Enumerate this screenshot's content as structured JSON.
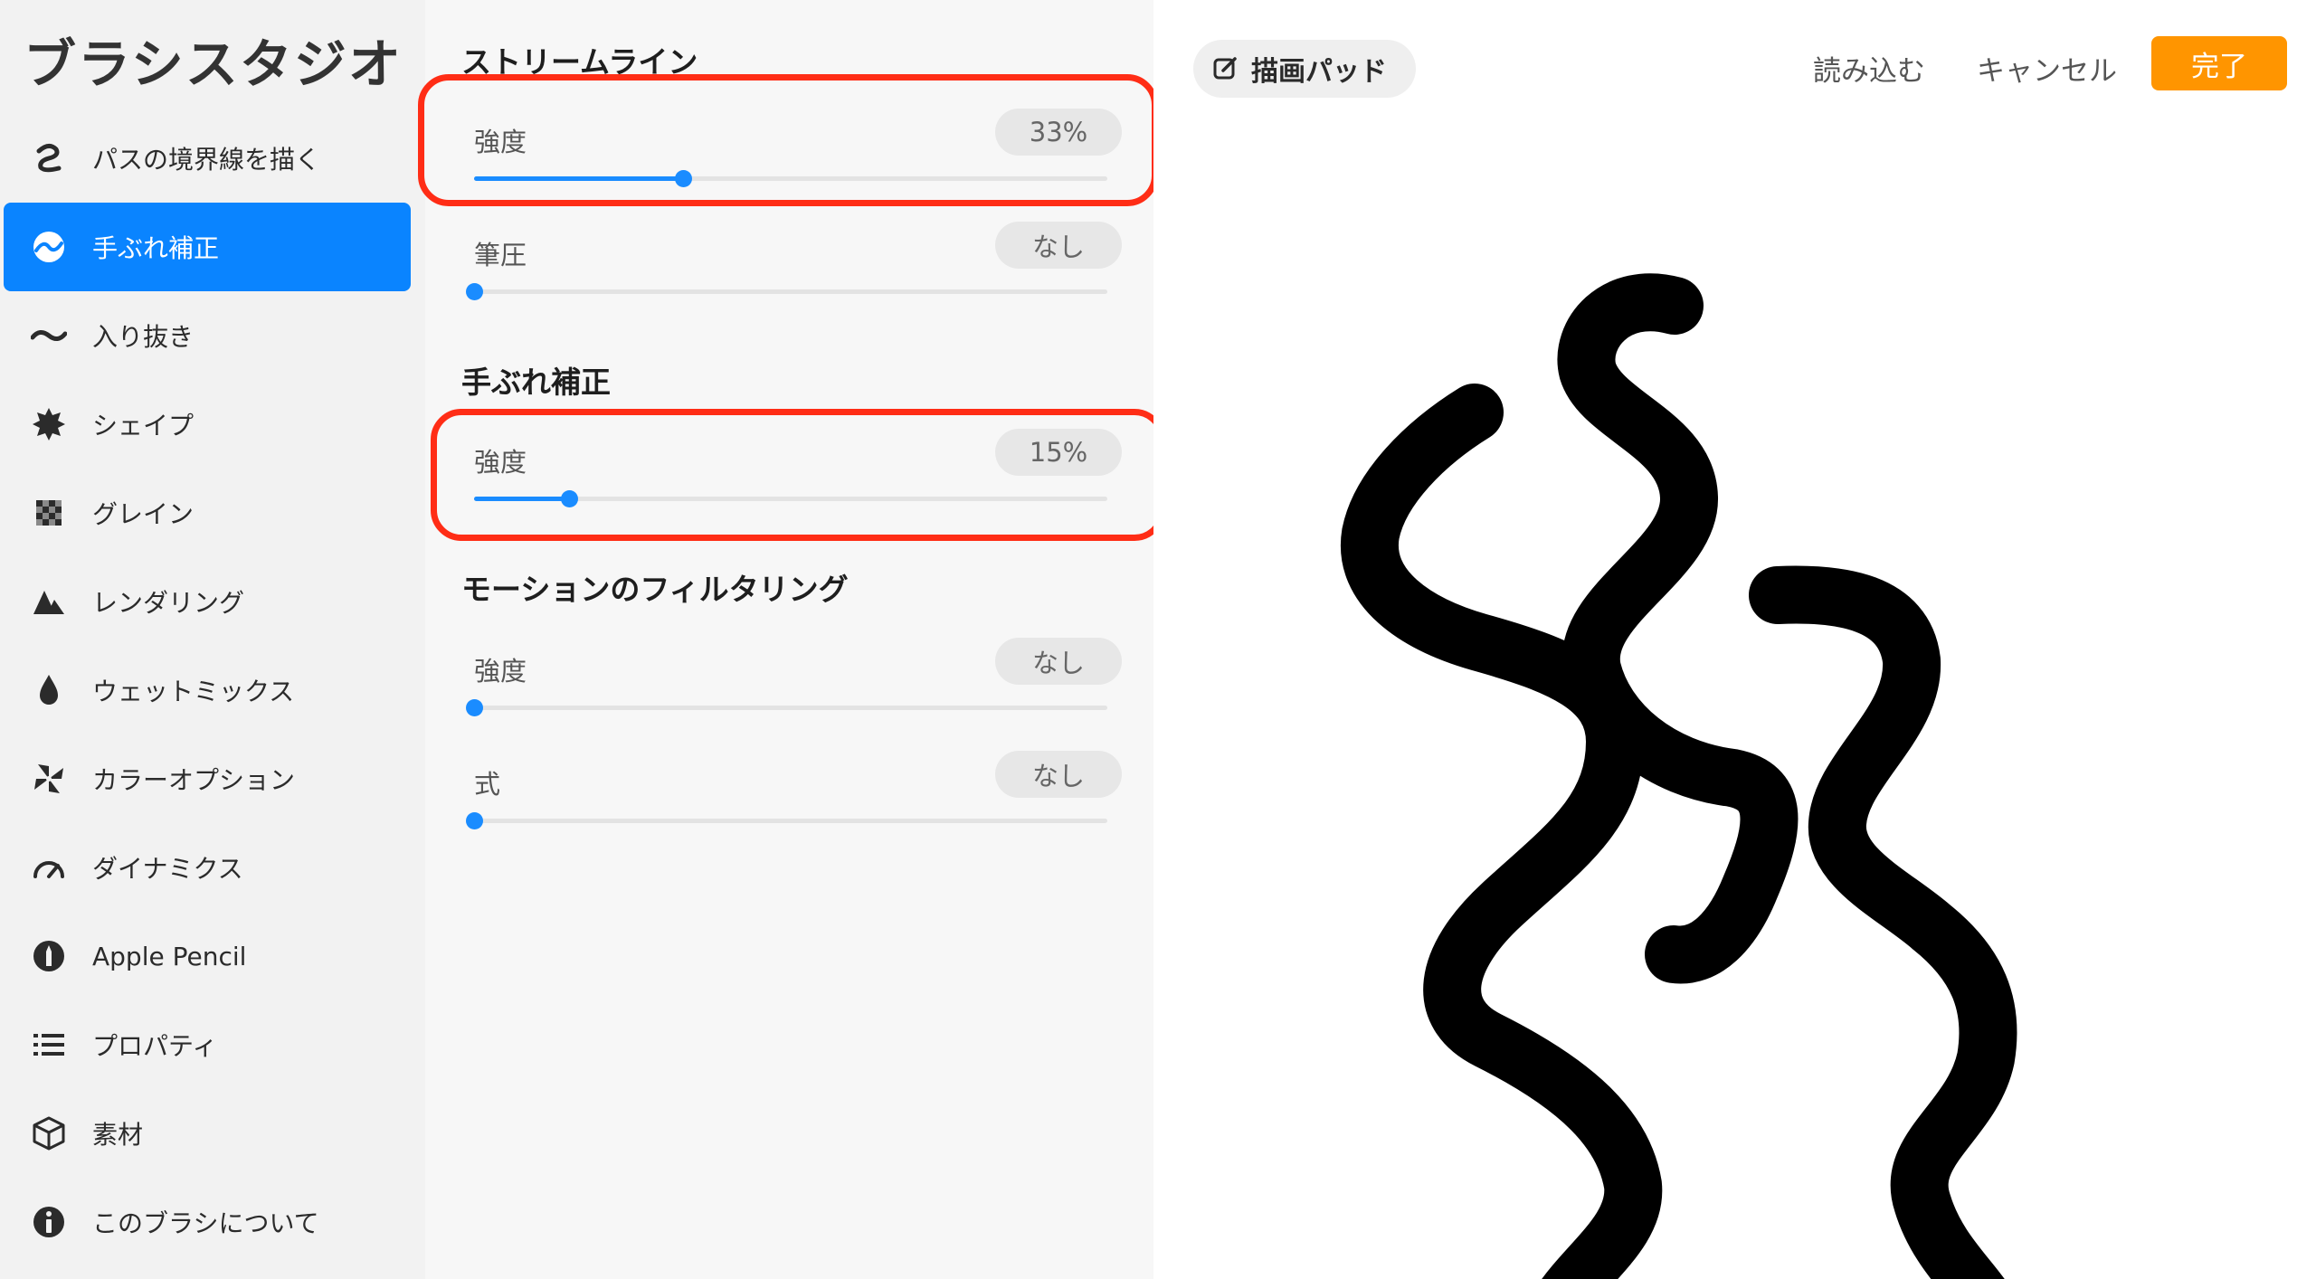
{
  "app": {
    "title": "ブラシスタジオ"
  },
  "sidebar": {
    "items": [
      {
        "label": "パスの境界線を描く",
        "icon": "stroke-path-icon",
        "active": false
      },
      {
        "label": "手ぶれ補正",
        "icon": "stabilization-icon",
        "active": true
      },
      {
        "label": "入り抜き",
        "icon": "taper-icon",
        "active": false
      },
      {
        "label": "シェイプ",
        "icon": "shape-icon",
        "active": false
      },
      {
        "label": "グレイン",
        "icon": "grain-icon",
        "active": false
      },
      {
        "label": "レンダリング",
        "icon": "rendering-icon",
        "active": false
      },
      {
        "label": "ウェットミックス",
        "icon": "wet-mix-icon",
        "active": false
      },
      {
        "label": "カラーオプション",
        "icon": "color-options-icon",
        "active": false
      },
      {
        "label": "ダイナミクス",
        "icon": "dynamics-icon",
        "active": false
      },
      {
        "label": "Apple Pencil",
        "icon": "apple-pencil-icon",
        "active": false
      },
      {
        "label": "プロパティ",
        "icon": "properties-icon",
        "active": false
      },
      {
        "label": "素材",
        "icon": "materials-icon",
        "active": false
      },
      {
        "label": "このブラシについて",
        "icon": "info-icon",
        "active": false
      }
    ]
  },
  "panel": {
    "streamline": {
      "title": "ストリームライン",
      "amount": {
        "label": "強度",
        "value": "33%",
        "level": 0.33
      },
      "pressure": {
        "label": "筆圧",
        "value": "なし",
        "level": 0
      }
    },
    "stabilization": {
      "title": "手ぶれ補正",
      "amount": {
        "label": "強度",
        "value": "15%",
        "level": 0.15
      }
    },
    "motion_filtering": {
      "title": "モーションのフィルタリング",
      "amount": {
        "label": "強度",
        "value": "なし",
        "level": 0
      },
      "expression": {
        "label": "式",
        "value": "なし",
        "level": 0
      }
    }
  },
  "pad": {
    "pill_label": "描画パッド",
    "import_label": "読み込む",
    "cancel_label": "キャンセル",
    "done_label": "完了"
  },
  "colors": {
    "accent": "#0a84ff",
    "slider": "#1a8cff",
    "done": "#ff9500",
    "highlight": "#ff2d16"
  }
}
